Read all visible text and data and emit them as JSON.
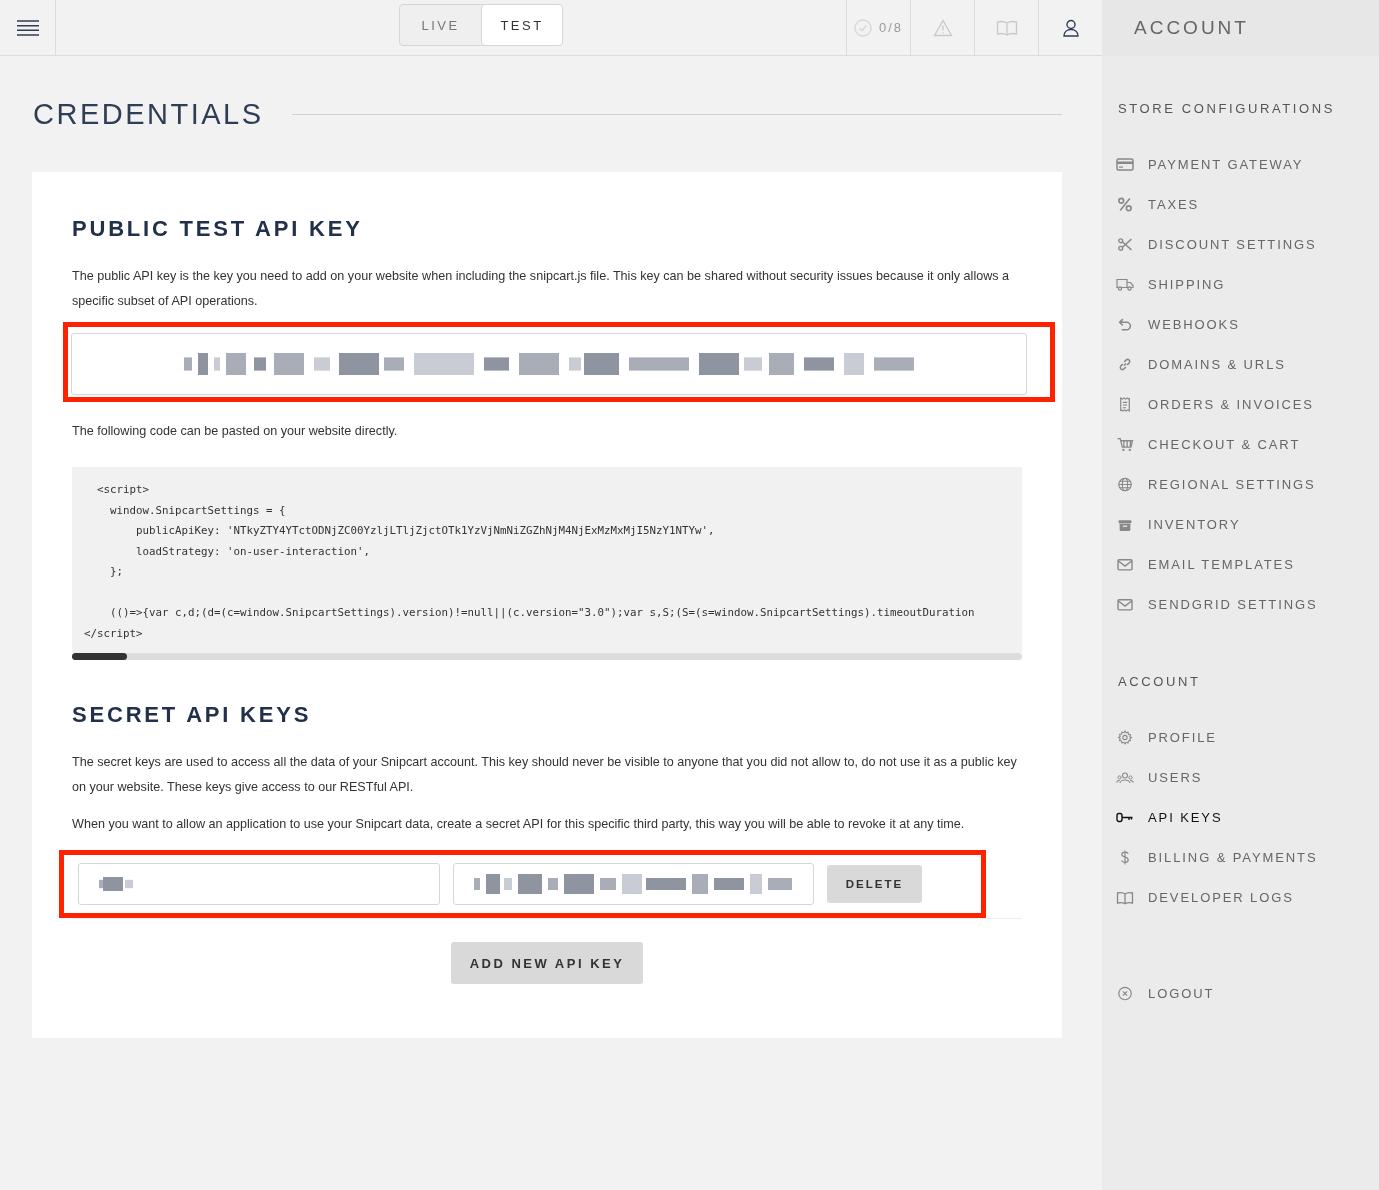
{
  "topbar": {
    "modes": [
      {
        "label": "LIVE",
        "selected": false
      },
      {
        "label": "TEST",
        "selected": true
      }
    ],
    "checklist": "0/8",
    "account_title": "ACCOUNT"
  },
  "page": {
    "title": "CREDENTIALS",
    "public": {
      "title": "PUBLIC TEST API KEY",
      "description": "The public API key is the key you need to add on your website when including the snipcart.js file. This key can be shared without security issues because it only allows a specific subset of API operations.",
      "code_intro": "The following code can be pasted on your website directly.",
      "code_groups": [
        [
          "  <script>",
          "    window.SnipcartSettings = {",
          "        publicApiKey: 'NTkyZTY4YTctODNjZC00YzljLTljZjctOTk1YzVjNmNiZGZhNjM4NjExMzMxMjI5NzY1NTYw',",
          "        loadStrategy: 'on-user-interaction',",
          "    };"
        ],
        [
          "    (()=>{var c,d;(d=(c=window.SnipcartSettings).version)!=null||(c.version=\"3.0\");var s,S;(S=(s=window.SnipcartSettings).timeoutDuration",
          "</script>"
        ]
      ]
    },
    "secret": {
      "title": "SECRET API KEYS",
      "paragraphs": [
        "The secret keys are used to access all the data of your Snipcart account. This key should never be visible to anyone that you did not allow to, do not use it as a public key on your website. These keys give access to our RESTful API.",
        "When you want to allow an application to use your Snipcart data, create a secret API for this specific third party, this way you will be able to revoke it at any time."
      ],
      "delete_label": "DELETE",
      "add_label": "ADD NEW API KEY"
    }
  },
  "sidebar": {
    "sections": [
      {
        "title": "STORE CONFIGURATIONS",
        "items": [
          {
            "label": "PAYMENT GATEWAY",
            "kind": "card",
            "selected": false
          },
          {
            "label": "TAXES",
            "kind": "percent",
            "selected": false
          },
          {
            "label": "DISCOUNT SETTINGS",
            "kind": "scissors",
            "selected": false
          },
          {
            "label": "SHIPPING",
            "kind": "truck",
            "selected": false
          },
          {
            "label": "WEBHOOKS",
            "kind": "undo",
            "selected": false
          },
          {
            "label": "DOMAINS & URLS",
            "kind": "link",
            "selected": false
          },
          {
            "label": "ORDERS & INVOICES",
            "kind": "receipt",
            "selected": false
          },
          {
            "label": "CHECKOUT & CART",
            "kind": "cart",
            "selected": false
          },
          {
            "label": "REGIONAL SETTINGS",
            "kind": "globe",
            "selected": false
          },
          {
            "label": "INVENTORY",
            "kind": "box",
            "selected": false
          },
          {
            "label": "EMAIL TEMPLATES",
            "kind": "mail",
            "selected": false
          },
          {
            "label": "SENDGRID SETTINGS",
            "kind": "mail",
            "selected": false
          }
        ]
      },
      {
        "title": "ACCOUNT",
        "items": [
          {
            "label": "PROFILE",
            "kind": "gear",
            "selected": false
          },
          {
            "label": "USERS",
            "kind": "users",
            "selected": false
          },
          {
            "label": "API KEYS",
            "kind": "key",
            "selected": true
          },
          {
            "label": "BILLING & PAYMENTS",
            "kind": "dollar",
            "selected": false
          },
          {
            "label": "DEVELOPER LOGS",
            "kind": "book",
            "selected": false
          }
        ]
      }
    ],
    "logout": {
      "label": "LOGOUT",
      "kind": "logout"
    }
  }
}
